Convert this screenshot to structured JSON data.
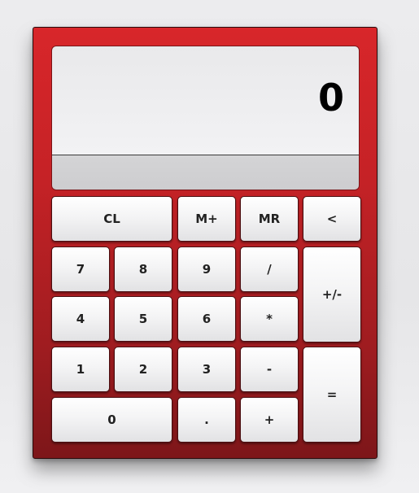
{
  "display": {
    "value": "0",
    "memory": ""
  },
  "keys": {
    "clear": "CL",
    "memory_add": "M+",
    "memory_recall": "MR",
    "backspace": "<",
    "seven": "7",
    "eight": "8",
    "nine": "9",
    "divide": "/",
    "negate": "+/-",
    "four": "4",
    "five": "5",
    "six": "6",
    "multiply": "*",
    "one": "1",
    "two": "2",
    "three": "3",
    "subtract": "-",
    "equals": "=",
    "zero": "0",
    "decimal": ".",
    "add": "+"
  },
  "colors": {
    "body": "#c52226",
    "key": "#f2f2f3",
    "display": "#eeeef0"
  }
}
